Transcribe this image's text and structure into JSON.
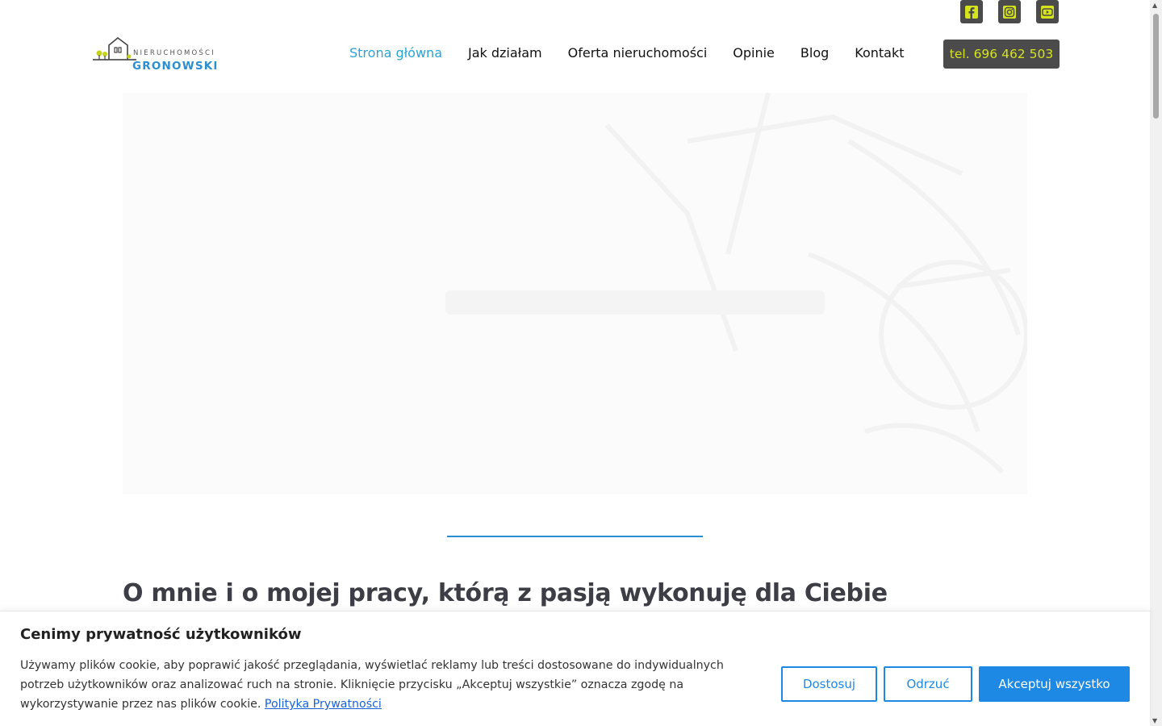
{
  "social": {
    "items": [
      {
        "name": "facebook-icon"
      },
      {
        "name": "instagram-icon"
      },
      {
        "name": "youtube-icon"
      }
    ]
  },
  "logo": {
    "top_text": "NIERUCHOMOŚCI",
    "main_text": "GRONOWSKI"
  },
  "nav": {
    "items": [
      {
        "label": "Strona główna",
        "active": true
      },
      {
        "label": "Jak działam"
      },
      {
        "label": "Oferta nieruchomości"
      },
      {
        "label": "Opinie"
      },
      {
        "label": "Blog"
      },
      {
        "label": "Kontakt"
      }
    ],
    "phone_label": "tel. 696 462 503"
  },
  "about": {
    "title": "O mnie i o mojej pracy, którą z pasją wykonuję dla Ciebie"
  },
  "cookie": {
    "title": "Cenimy prywatność użytkowników",
    "text": "Używamy plików cookie, aby poprawić jakość przeglądania, wyświetlać reklamy lub treści dostosowane do indywidualnych potrzeb użytkowników oraz analizować ruch na stronie. Kliknięcie przycisku „Akceptuj wszystkie” oznacza zgodę na wykorzystywanie przez nas plików cookie.",
    "link_label": "Polityka Prywatności",
    "customize_label": "Dostosuj",
    "reject_label": "Odrzuć",
    "accept_label": "Akceptuj wszystko"
  },
  "colors": {
    "accent_blue": "#2aa3d6",
    "button_blue": "#1e88e5",
    "dark_button": "#4b4b4b",
    "phone_text": "#d6e41b"
  }
}
